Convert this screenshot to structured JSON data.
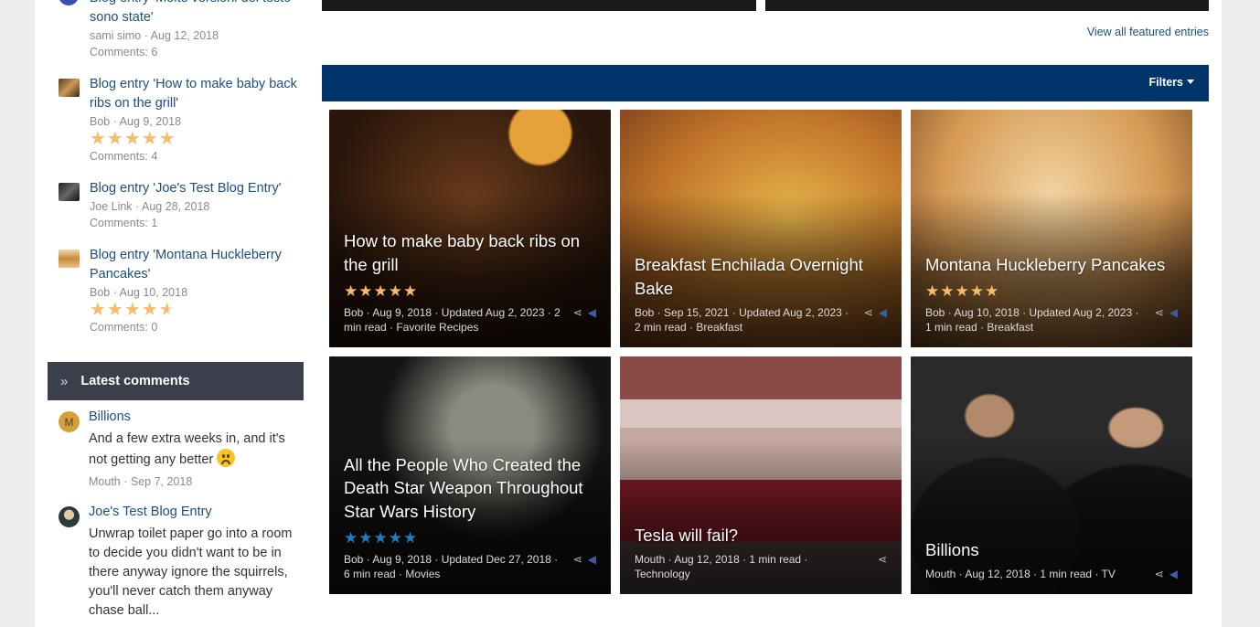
{
  "colors": {
    "link": "#1c4e80",
    "filter_bar": "#00346b",
    "block_head": "#3a3f4b",
    "star": "#f5bd6b",
    "star_blue": "#1f7ec0"
  },
  "recent_activity": [
    {
      "title": "Blog entry 'Molte versioni del testo sono state'",
      "meta": "sami simo · Aug 12, 2018",
      "stars": "",
      "comments": "Comments: 6"
    },
    {
      "title": "Blog entry 'How to make baby back ribs on the grill'",
      "meta": "Bob · Aug 9, 2018",
      "stars": "★★★★★",
      "comments": "Comments: 4"
    },
    {
      "title": "Blog entry 'Joe's Test Blog Entry'",
      "meta": "Joe Link · Aug 28, 2018",
      "stars": "",
      "comments": "Comments: 1"
    },
    {
      "title": "Blog entry 'Montana Huckleberry Pancakes'",
      "meta": "Bob · Aug 10, 2018",
      "stars": "★★★★",
      "stars_half": "★",
      "comments": "Comments: 0"
    }
  ],
  "latest_comments": {
    "heading": "Latest comments",
    "items": [
      {
        "avatar_letter": "M",
        "title": "Billions",
        "text": "And a few extra weeks in, and it's not getting any better",
        "meta": "Mouth · Sep 7, 2018"
      },
      {
        "avatar_letter": "",
        "title": "Joe's Test Blog Entry",
        "text": "Unwrap toilet paper go into a room to decide you didn't want to be in there anyway ignore the squirrels, you'll never catch them anyway chase ball...",
        "meta": ""
      }
    ]
  },
  "main": {
    "view_all": "View all featured entries",
    "filters": "Filters"
  },
  "cards": [
    {
      "title": "How to make baby back ribs on the grill",
      "stars": "★★★★★",
      "meta": "Bob · Aug 9, 2018 · Updated Aug 2, 2023 · 2 min read · Favorite Recipes"
    },
    {
      "title": "Breakfast Enchilada Overnight Bake",
      "stars": "",
      "meta": "Bob · Sep 15, 2021 · Updated Aug 2, 2023 · 2 min read · Breakfast"
    },
    {
      "title": "Montana Huckleberry Pancakes",
      "stars": "★★★★★",
      "meta": "Bob · Aug 10, 2018 · Updated Aug 2, 2023 · 1 min read · Breakfast"
    },
    {
      "title": "All the People Who Created the Death Star Weapon Throughout Star Wars History",
      "stars": "★★★★★",
      "meta": "Bob · Aug 9, 2018 · Updated Dec 27, 2018 · 6 min read · Movies"
    },
    {
      "title": "Tesla will fail?",
      "stars": "",
      "meta": "Mouth · Aug 12, 2018 · 1 min read · Technology"
    },
    {
      "title": "Billions",
      "stars": "",
      "meta": "Mouth · Aug 12, 2018 · 1 min read · TV"
    }
  ]
}
